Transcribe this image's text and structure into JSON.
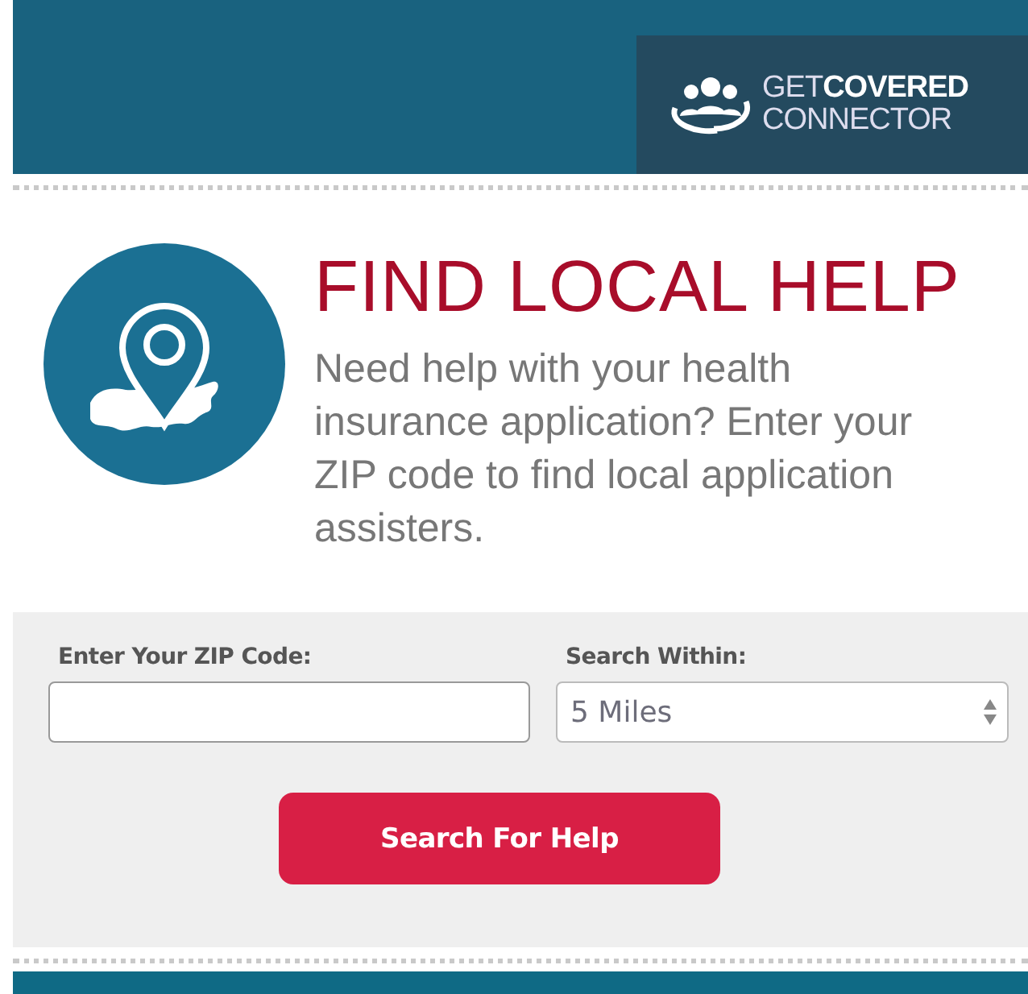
{
  "header": {
    "logo_line_1": "GET**COVERED**",
    "logo_line_2": "CONNECTOR"
  },
  "title": "FIND LOCAL HELP",
  "description": "Need help with your health insurance application? Enter your ZIP code to find local application assisters.",
  "form": {
    "zip": {
      "label": "Enter Your ZIP Code:"
    },
    "distance": {
      "label": "Search Within:",
      "value": "5 Miles"
    },
    "button": "Search For Help"
  }
}
